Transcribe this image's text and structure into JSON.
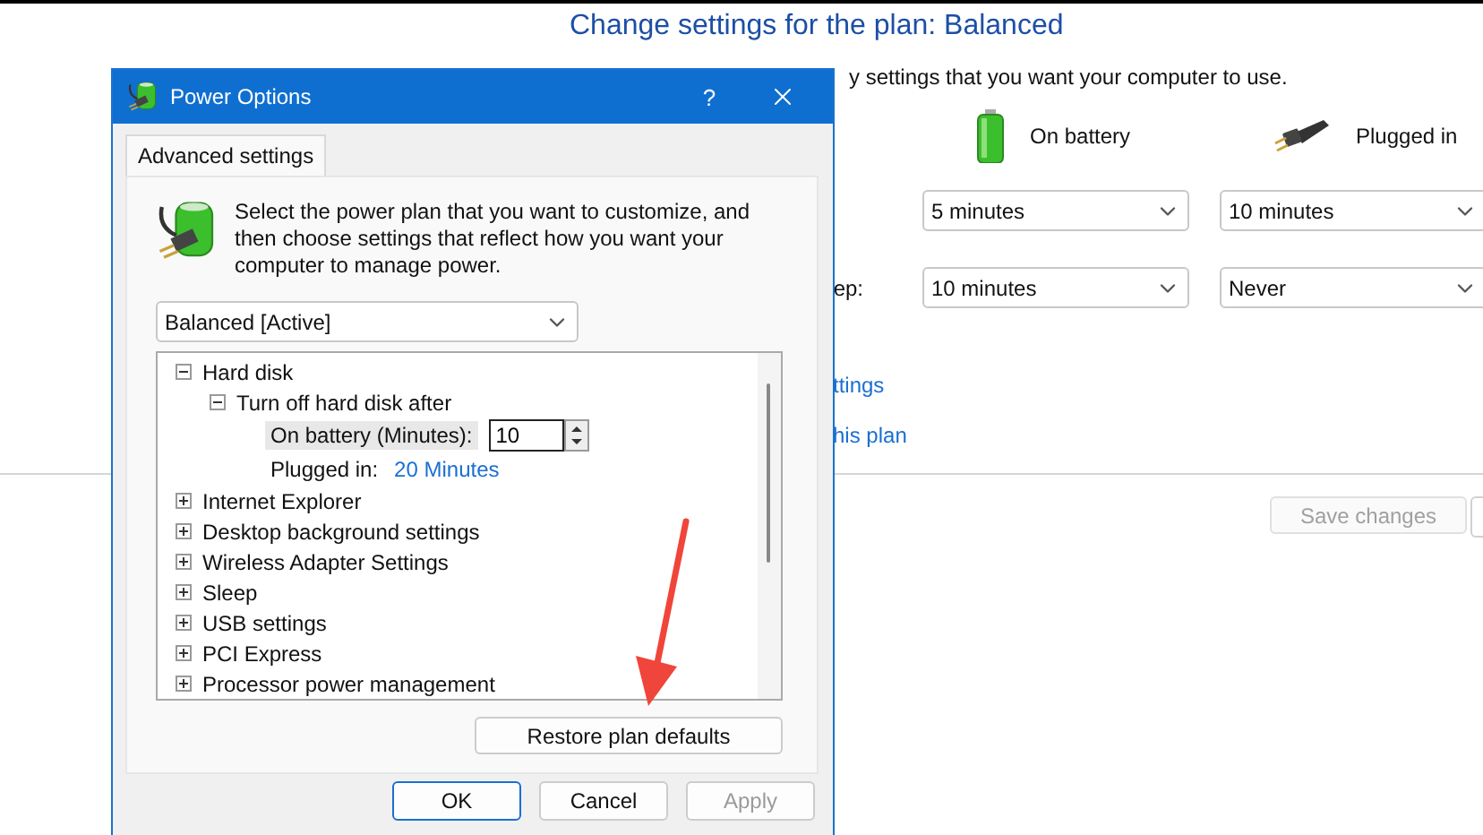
{
  "background": {
    "title": "Change settings for the plan: Balanced",
    "subtitle": "y settings that you want your computer to use.",
    "columns": [
      {
        "kind": "battery",
        "label": "On battery"
      },
      {
        "kind": "plug",
        "label": "Plugged in"
      }
    ],
    "rows": [
      {
        "values": [
          "5 minutes",
          "10 minutes"
        ]
      },
      {
        "label": "ep:",
        "values": [
          "10 minutes",
          "Never"
        ]
      }
    ],
    "links": [
      "ttings",
      "his plan"
    ],
    "save_button": {
      "label": "Save changes",
      "disabled": true
    }
  },
  "dialog": {
    "title": "Power Options",
    "help": "?",
    "tabs": [
      {
        "label": "Advanced settings",
        "selected": true
      }
    ],
    "description": "Select the power plan that you want to customize, and then choose settings that reflect how you want your computer to manage power.",
    "plan_select": "Balanced [Active]",
    "tree": [
      {
        "label": "Hard disk",
        "expanded": true,
        "children": [
          {
            "label": "Turn off hard disk after",
            "expanded": true,
            "children": [
              {
                "kind": "spin",
                "label": "On battery (Minutes):",
                "value": "10",
                "selected": true
              },
              {
                "kind": "link",
                "label": "Plugged in:",
                "value": "20 Minutes",
                "selected": false
              }
            ]
          }
        ]
      },
      {
        "label": "Internet Explorer",
        "expanded": false
      },
      {
        "label": "Desktop background settings",
        "expanded": false
      },
      {
        "label": "Wireless Adapter Settings",
        "expanded": false
      },
      {
        "label": "Sleep",
        "expanded": false
      },
      {
        "label": "USB settings",
        "expanded": false
      },
      {
        "label": "PCI Express",
        "expanded": false
      },
      {
        "label": "Processor power management",
        "expanded": false
      }
    ],
    "restore_button": "Restore plan defaults",
    "buttons": [
      {
        "label": "OK",
        "default": true,
        "disabled": false
      },
      {
        "label": "Cancel",
        "default": false,
        "disabled": false
      },
      {
        "label": "Apply",
        "default": false,
        "disabled": true
      }
    ]
  }
}
